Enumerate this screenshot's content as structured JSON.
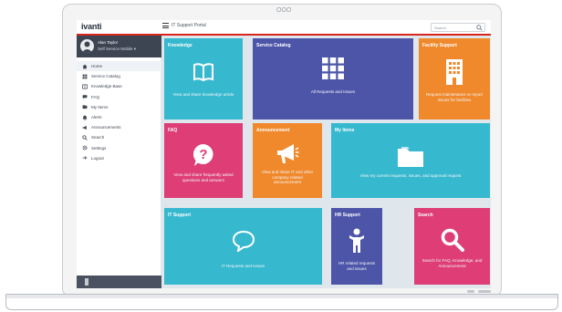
{
  "device": {
    "camera": "OOO"
  },
  "header": {
    "logo": "ivanti",
    "portal_title": "IT Support Portal",
    "search_placeholder": "Search"
  },
  "sidebar": {
    "user_name": "Alan Taylor",
    "user_role": "Self Service Mobile ▾",
    "items": [
      {
        "label": "Home",
        "icon": "home-icon",
        "active": true
      },
      {
        "label": "Service Catalog",
        "icon": "catalog-icon"
      },
      {
        "label": "Knowledge Base",
        "icon": "book-icon"
      },
      {
        "label": "FAQ",
        "icon": "chat-icon"
      },
      {
        "label": "My Items",
        "icon": "folder-icon"
      },
      {
        "label": "Alerts",
        "icon": "bell-icon"
      },
      {
        "label": "Announcements",
        "icon": "megaphone-icon"
      },
      {
        "label": "Search",
        "icon": "search-icon"
      },
      {
        "label": "Settings",
        "icon": "gear-icon"
      },
      {
        "label": "Logout",
        "icon": "logout-icon"
      }
    ]
  },
  "tiles": {
    "knowledge": {
      "title": "Knowledge",
      "desc": "View and share knowledge article",
      "color": "#36b8cf"
    },
    "catalog": {
      "title": "Service Catalog",
      "desc": "All Requests and Issues",
      "color": "#4d55a8"
    },
    "facility": {
      "title": "Facility Support",
      "desc": "Request maintenance or report issues for facilities",
      "color": "#f0892c"
    },
    "faq": {
      "title": "FAQ",
      "desc": "View and share frequently asked questions and answers",
      "color": "#de3d76"
    },
    "announce": {
      "title": "Announcement",
      "desc": "View and share IT and other company related announcement",
      "color": "#f0892c"
    },
    "myitems": {
      "title": "My Items",
      "desc": "View my current requests, issues, and approval request",
      "color": "#36b8cf"
    },
    "itsupport": {
      "title": "IT Support",
      "desc": "IT Requests and Issues",
      "color": "#36b8cf"
    },
    "hrsupport": {
      "title": "HR Support",
      "desc": "HR related requests and issues",
      "color": "#4d55a8"
    },
    "search": {
      "title": "Search",
      "desc": "Search for FAQ, Knowledge, and Announcement",
      "color": "#de3d76"
    }
  }
}
